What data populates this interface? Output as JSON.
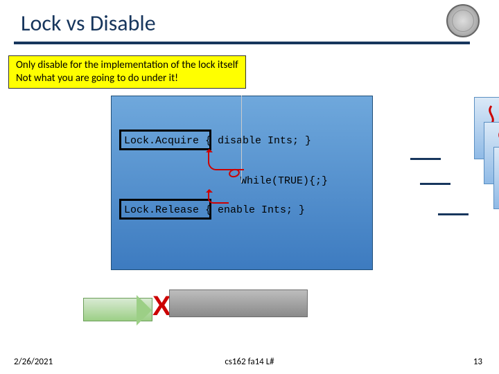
{
  "title": "Lock vs Disable",
  "callout": {
    "line1": "Only disable for the implementation of the lock itself",
    "line2": "Not what you are going to do under it!"
  },
  "code": {
    "acquire": "Lock.Acquire { disable Ints; }",
    "loop": "While(TRUE){;}",
    "release": "Lock.Release { enable Ints; }"
  },
  "footer": {
    "date": "2/26/2021",
    "center": "cs162 fa14 L#",
    "page": "13"
  }
}
